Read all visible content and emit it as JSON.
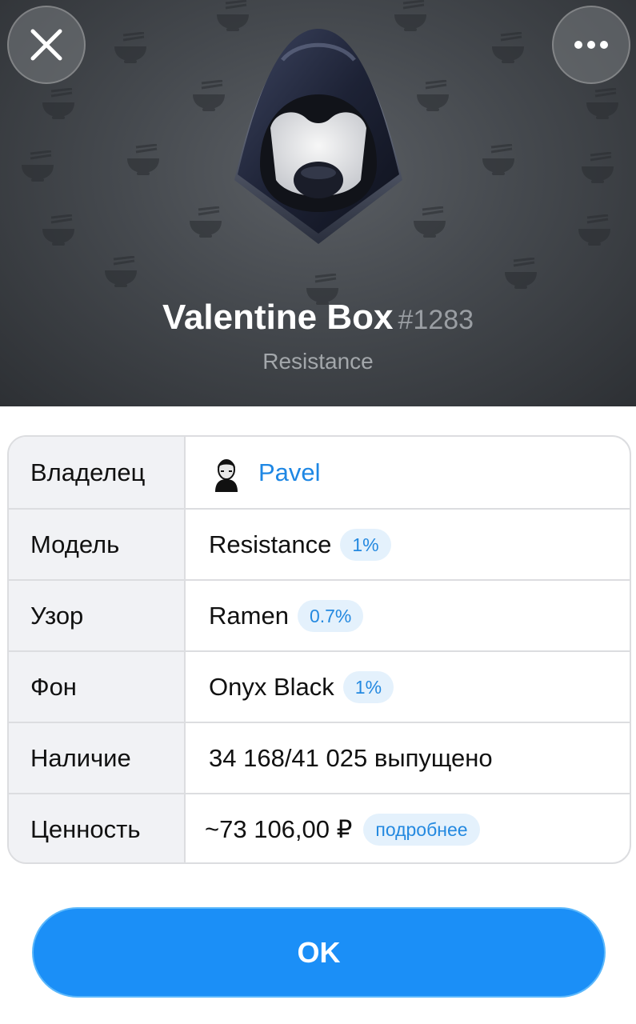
{
  "header": {
    "gift_name": "Valentine Box",
    "gift_number": "#1283",
    "subtitle": "Resistance",
    "close_icon": "close-icon",
    "more_icon": "more-dots-icon",
    "pattern_icon": "ramen-bowl-icon",
    "background_color": "#45494e"
  },
  "details": {
    "owner": {
      "label": "Владелец",
      "value": "Pavel"
    },
    "model": {
      "label": "Модель",
      "value": "Resistance",
      "badge": "1%"
    },
    "pattern": {
      "label": "Узор",
      "value": "Ramen",
      "badge": "0.7%"
    },
    "backdrop": {
      "label": "Фон",
      "value": "Onyx Black",
      "badge": "1%"
    },
    "availability": {
      "label": "Наличие",
      "value": "34 168/41 025 выпущено"
    },
    "value": {
      "label": "Ценность",
      "value": "~73 106,00 ₽",
      "badge": "подробнее"
    }
  },
  "footer": {
    "ok_label": "OK",
    "accent_color": "#1b8ff7"
  }
}
